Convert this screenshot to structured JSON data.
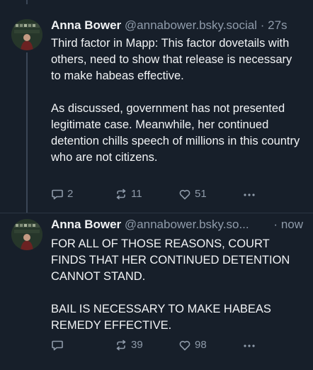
{
  "posts": [
    {
      "author_name": "Anna Bower",
      "handle": "@annabower.bsky.social",
      "separator": "·",
      "time": "27s",
      "text": "Third factor in Mapp: This factor dovetails with others, need to show that release is necessary to make habeas effective.\n\nAs discussed, government has not presented legitimate case. Meanwhile, her continued detention chills speech of millions in this country who are not citizens.",
      "reply_count": "2",
      "repost_count": "11",
      "like_count": "51"
    },
    {
      "author_name": "Anna Bower",
      "handle": "@annabower.bsky.so...",
      "separator": "·",
      "time": "now",
      "text": "FOR ALL OF THOSE REASONS, COURT FINDS THAT HER CONTINUED DETENTION CANNOT STAND.\n\nBAIL IS NECESSARY TO MAKE HABEAS REMEDY EFFECTIVE.",
      "reply_count": "",
      "repost_count": "39",
      "like_count": "98"
    }
  ],
  "icons": {
    "reply": "reply-icon",
    "repost": "repost-icon",
    "like": "heart-icon",
    "more": "more-options-icon"
  },
  "colors": {
    "background": "#171f2a",
    "text": "#f1f3f5",
    "muted": "#8f9baa"
  }
}
